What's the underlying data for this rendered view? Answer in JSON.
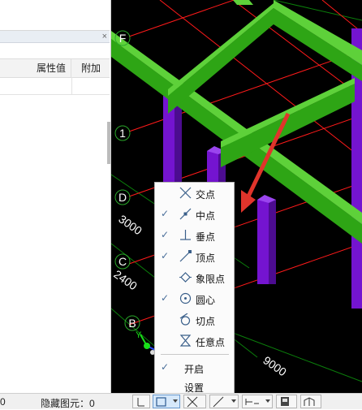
{
  "property_panel": {
    "close_glyph": "×",
    "columns": [
      "属性值",
      "附加"
    ]
  },
  "viewport": {
    "axis_labels": [
      "F",
      "1",
      "D",
      "C",
      "B"
    ],
    "dimensions": [
      "3000",
      "2400",
      "9000"
    ],
    "axis_y_label": "Y"
  },
  "context_menu": {
    "items": [
      {
        "label": "交点",
        "checked": false,
        "icon": "intersection-icon"
      },
      {
        "label": "中点",
        "checked": true,
        "icon": "midpoint-icon"
      },
      {
        "label": "垂点",
        "checked": true,
        "icon": "perpendicular-icon"
      },
      {
        "label": "顶点",
        "checked": true,
        "icon": "vertex-icon"
      },
      {
        "label": "象限点",
        "checked": false,
        "icon": "quadrant-icon"
      },
      {
        "label": "圆心",
        "checked": true,
        "icon": "center-icon"
      },
      {
        "label": "切点",
        "checked": false,
        "icon": "tangent-icon"
      },
      {
        "label": "任意点",
        "checked": false,
        "icon": "nearest-icon"
      }
    ],
    "enable": {
      "label": "开启",
      "checked": true
    },
    "settings": {
      "label": "设置"
    },
    "check_glyph": "✓"
  },
  "statusbar": {
    "left_value": "0",
    "hidden_elements": "隐藏图元：0"
  },
  "colors": {
    "beam": "#2fa516",
    "column": "#7d16d8",
    "axis_line": "#ff1a1a",
    "grid_line": "#0a8a0a",
    "arrow": "#e0342b",
    "check": "#4a6f9a"
  }
}
